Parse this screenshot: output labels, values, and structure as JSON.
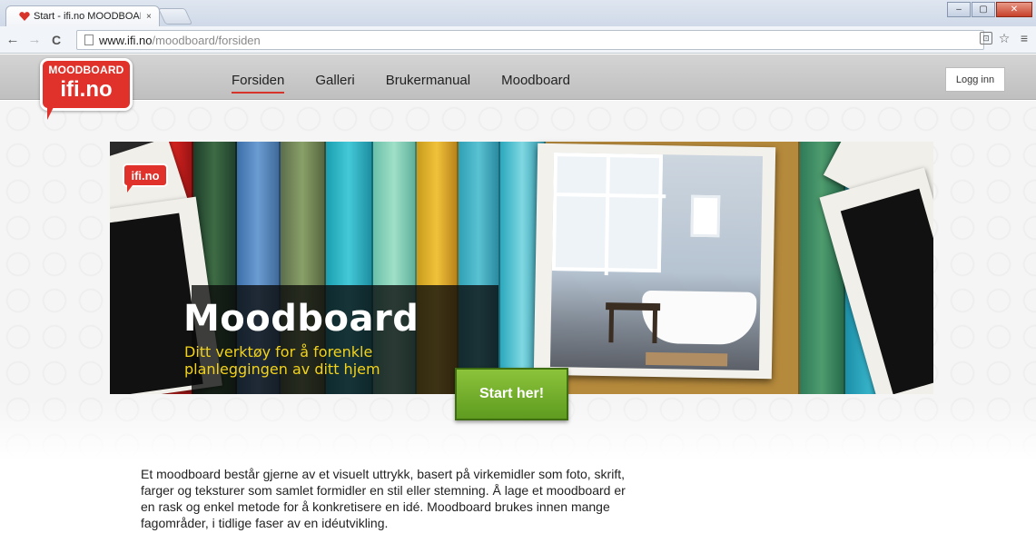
{
  "browser": {
    "tab_title": "Start - ifi.no MOODBOARD",
    "tab_close": "×",
    "window_buttons": {
      "minimize": "–",
      "maximize": "▢",
      "close": "✕"
    },
    "nav": {
      "back": "←",
      "forward": "→",
      "reload": "C"
    },
    "url_host": "www.ifi.no",
    "url_path": "/moodboard/forsiden",
    "toolbar_icons": {
      "extension": "⊡",
      "star": "☆",
      "menu": "≡"
    }
  },
  "site": {
    "logo": {
      "top": "MOODBOARD",
      "main": "ifi.no"
    },
    "nav": [
      {
        "label": "Forsiden",
        "active": true
      },
      {
        "label": "Galleri",
        "active": false
      },
      {
        "label": "Brukermanual",
        "active": false
      },
      {
        "label": "Moodboard",
        "active": false
      }
    ],
    "login_label": "Logg inn"
  },
  "hero": {
    "small_logo": "ifi.no",
    "title": "Moodboard",
    "subtitle": "Ditt verktøy for å forenkle planleggingen av ditt hjem",
    "cta_label": "Start her!",
    "colors": {
      "accent_red": "#e0312a",
      "subtitle_yellow": "#f2d21b",
      "cta_green": "#6fac27"
    }
  },
  "intro": {
    "text": "Et moodboard består gjerne av et visuelt uttrykk, basert på virkemidler som foto, skrift, farger og teksturer som samlet formidler en stil eller stemning. Å lage et moodboard er en rask og enkel metode for å konkretisere en idé. Moodboard brukes innen mange fagområder, i tidlige faser av en idéutvikling."
  }
}
